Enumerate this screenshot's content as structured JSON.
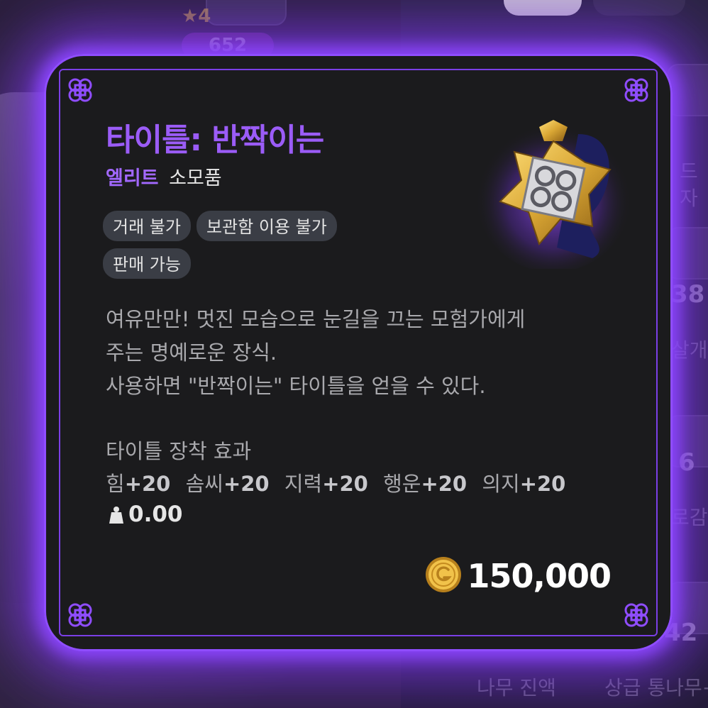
{
  "background": {
    "star_rating": "★4",
    "count_badge": "652",
    "side_labels": [
      "드",
      "자",
      "살개",
      "로감"
    ],
    "side_numbers": [
      "38",
      "6",
      "42"
    ],
    "bottom_labels": [
      "나무 진액",
      "상급 통나무+"
    ]
  },
  "tooltip": {
    "title": "타이틀: 반짝이는",
    "grade": "엘리트",
    "item_type": "소모품",
    "tags": [
      "거래 불가",
      "보관함 이용 불가",
      "판매 가능"
    ],
    "description_lines": [
      "여유만만! 멋진 모습으로 눈길을 끄는 모험가에게",
      "주는 명예로운 장식.",
      "사용하면 \"반짝이는\" 타이틀을 얻을 수 있다."
    ],
    "effect_heading": "타이틀 장착 효과",
    "stats": [
      {
        "name": "힘",
        "value": "+20"
      },
      {
        "name": "솜씨",
        "value": "+20"
      },
      {
        "name": "지력",
        "value": "+20"
      },
      {
        "name": "행운",
        "value": "+20"
      },
      {
        "name": "의지",
        "value": "+20"
      }
    ],
    "weight": "0.00",
    "weight_icon": "weight-icon",
    "price": "150,000",
    "price_icon": "gold-coin-icon",
    "item_icon": "title-medal-icon"
  },
  "colors": {
    "accent_purple": "#9b5cf7",
    "glow_purple": "#8f4dff",
    "card_bg": "#1b1b1d",
    "tag_bg": "#3a3d45",
    "gold": "#d9a634"
  }
}
